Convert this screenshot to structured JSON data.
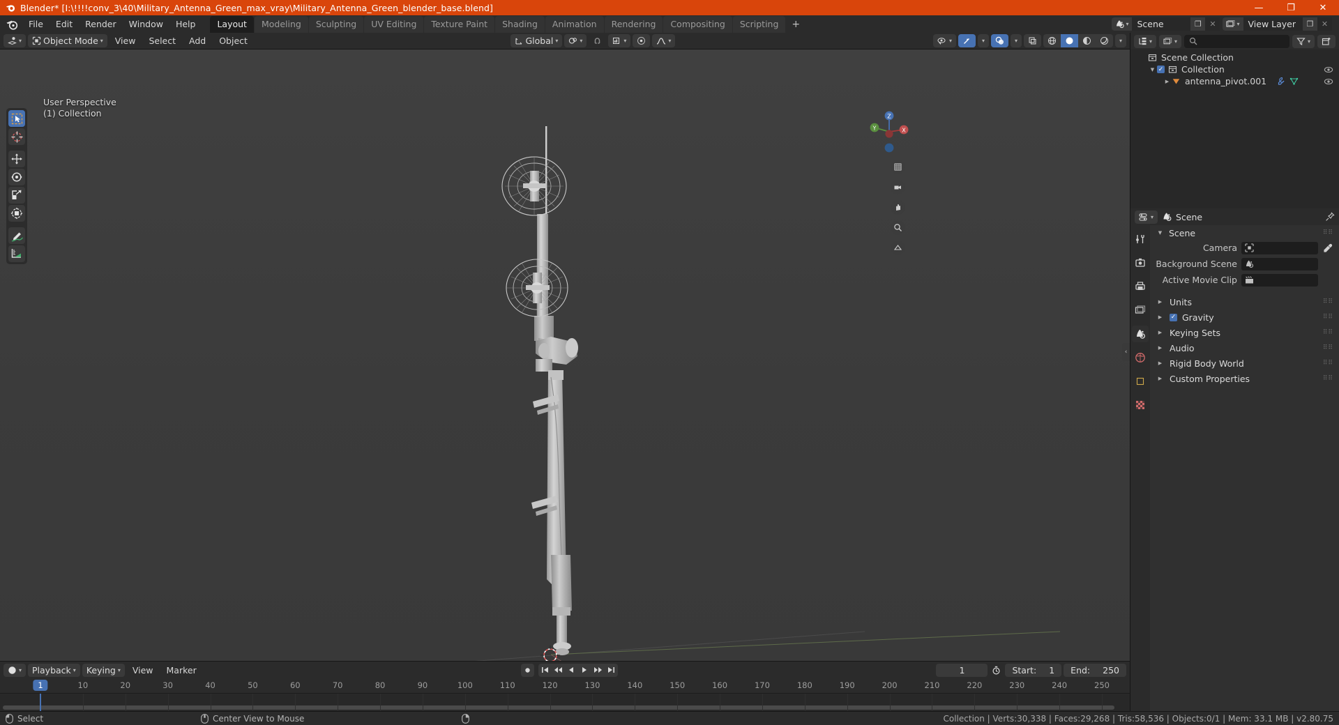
{
  "window": {
    "title": "Blender* [I:\\!!!!conv_3\\40\\Military_Antenna_Green_max_vray\\Military_Antenna_Green_blender_base.blend]",
    "minimize": "—",
    "maximize": "❐",
    "close": "✕",
    "accent_color": "#d9450b"
  },
  "topbar": {
    "menus": [
      "File",
      "Edit",
      "Render",
      "Window",
      "Help"
    ],
    "tabs": [
      {
        "label": "Layout",
        "active": true
      },
      {
        "label": "Modeling",
        "active": false
      },
      {
        "label": "Sculpting",
        "active": false
      },
      {
        "label": "UV Editing",
        "active": false
      },
      {
        "label": "Texture Paint",
        "active": false
      },
      {
        "label": "Shading",
        "active": false
      },
      {
        "label": "Animation",
        "active": false
      },
      {
        "label": "Rendering",
        "active": false
      },
      {
        "label": "Compositing",
        "active": false
      },
      {
        "label": "Scripting",
        "active": false
      }
    ],
    "add_tab": "+",
    "scene_name": "Scene",
    "view_layer_name": "View Layer",
    "copy_glyph": "❐",
    "close_glyph": "✕"
  },
  "viewport_header": {
    "mode": "Object Mode",
    "menus": [
      "View",
      "Select",
      "Add",
      "Object"
    ],
    "orientation": "Global"
  },
  "viewport": {
    "perspective_label": "User Perspective",
    "collection_label": "(1) Collection",
    "gizmo_axes": {
      "z": "Z",
      "y": "Y",
      "x": "X"
    },
    "tools": [
      "tweak-select-tool",
      "cursor-tool",
      "move-tool",
      "rotate-tool",
      "scale-tool",
      "transform-tool",
      "annotate-tool",
      "measure-tool"
    ]
  },
  "outliner": {
    "search_placeholder": "",
    "rows": [
      {
        "label": "Scene Collection",
        "indent": 0,
        "kind": "collection",
        "disclosure": "",
        "checkbox": false,
        "eye": false
      },
      {
        "label": "Collection",
        "indent": 1,
        "kind": "collection",
        "disclosure": "▼",
        "checkbox": true,
        "eye": true
      },
      {
        "label": "antenna_pivot.001",
        "indent": 2,
        "kind": "object",
        "disclosure": "▶",
        "checkbox": false,
        "eye": true
      }
    ]
  },
  "properties": {
    "breadcrumb": "Scene",
    "panel_title": "Scene",
    "fields": [
      {
        "label": "Camera",
        "value": "",
        "icon": "camera-data-icon",
        "eyedropper": true
      },
      {
        "label": "Background Scene",
        "value": "",
        "icon": "scene-icon",
        "eyedropper": false
      },
      {
        "label": "Active Movie Clip",
        "value": "",
        "icon": "clip-icon",
        "eyedropper": false
      }
    ],
    "sections": [
      {
        "label": "Units",
        "checkbox": false
      },
      {
        "label": "Gravity",
        "checkbox": true
      },
      {
        "label": "Keying Sets",
        "checkbox": false
      },
      {
        "label": "Audio",
        "checkbox": false
      },
      {
        "label": "Rigid Body World",
        "checkbox": false
      },
      {
        "label": "Custom Properties",
        "checkbox": false
      }
    ],
    "tabs": [
      "tool-tab",
      "render-tab",
      "output-tab",
      "view-layer-tab",
      "scene-tab",
      "world-tab",
      "object-tab",
      "texture-tab"
    ]
  },
  "timeline": {
    "menus": [
      "Playback",
      "Keying",
      "View",
      "Marker"
    ],
    "current_frame": "1",
    "start_label": "Start:",
    "start_value": "1",
    "end_label": "End:",
    "end_value": "250",
    "ticks": [
      "1",
      "10",
      "20",
      "30",
      "40",
      "50",
      "60",
      "70",
      "80",
      "90",
      "100",
      "110",
      "120",
      "130",
      "140",
      "150",
      "160",
      "170",
      "180",
      "190",
      "200",
      "210",
      "220",
      "230",
      "240",
      "250"
    ],
    "playhead_frame": "1"
  },
  "statusbar": {
    "items": [
      {
        "icon": "mouse-left-icon",
        "label": "Select"
      },
      {
        "icon": "mouse-middle-icon",
        "label": "Center View to Mouse"
      },
      {
        "icon": "mouse-right-icon",
        "label": ""
      }
    ],
    "stats": "Collection | Verts:30,338 | Faces:29,268 | Tris:58,536 | Objects:0/1 | Mem: 33.1 MB | v2.80.75"
  }
}
